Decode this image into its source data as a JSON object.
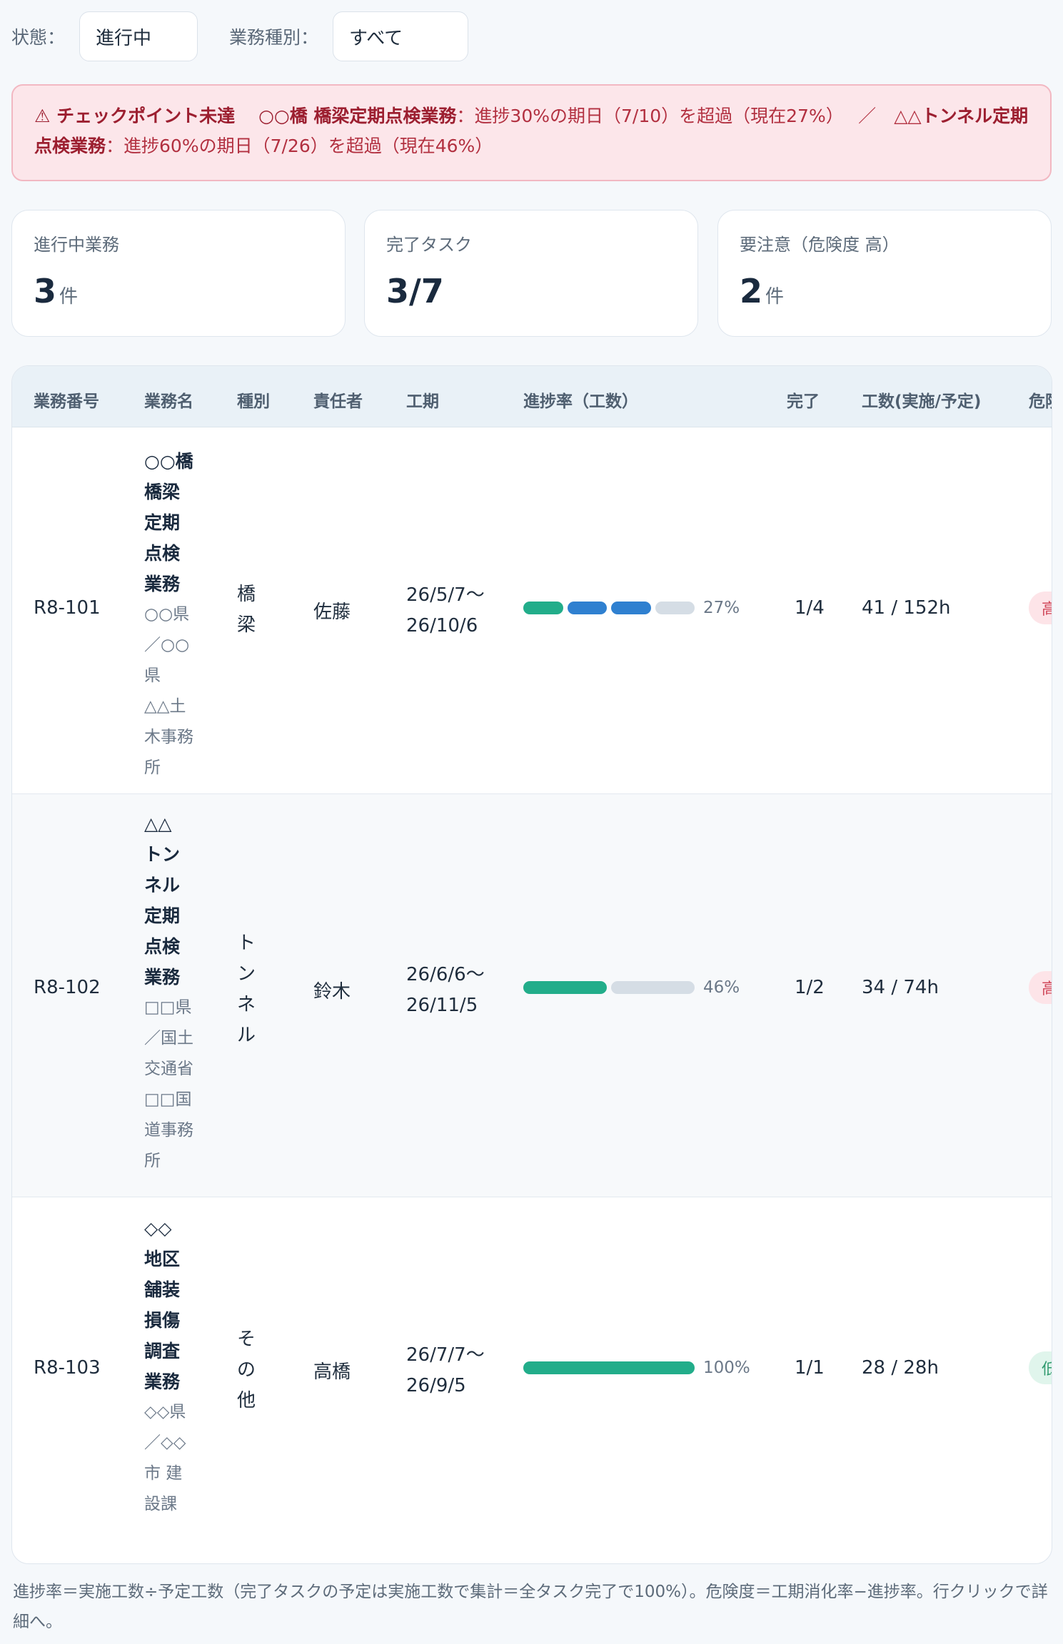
{
  "filters": {
    "status_label": "状態：",
    "status_value": "進行中",
    "type_label": "業務種別：",
    "type_value": "すべて"
  },
  "alert": {
    "icon_title": "⚠ チェックポイント未達",
    "item1_name": "○○橋 橋梁定期点検業務",
    "item1_text": "：進捗30%の期日（7/10）を超過（現在27%）",
    "separator": "／",
    "item2_prefix": "△△",
    "item2_name": "トンネル定期点検業務",
    "item2_text": "：進捗60%の期日（7/26）を超過（現在46%）"
  },
  "stats": [
    {
      "label": "進行中業務",
      "value": "3",
      "unit": "件"
    },
    {
      "label": "完了タスク",
      "value": "3/7",
      "unit": ""
    },
    {
      "label": "要注意（危険度 高）",
      "value": "2",
      "unit": "件"
    }
  ],
  "table": {
    "headers": [
      "業務番号",
      "業務名",
      "種別",
      "責任者",
      "工期",
      "進捗率（工数）",
      "完了",
      "工数(実施/予定)",
      "危険"
    ],
    "rows": [
      {
        "id": "R8-101",
        "name_lines": [
          "○○橋",
          "橋梁",
          "定期",
          "点検",
          "業務"
        ],
        "client_lines": [
          "○○県",
          "／○○",
          "県",
          "△△土",
          "木事務",
          "所"
        ],
        "type_lines": [
          "橋",
          "梁"
        ],
        "manager": "佐藤",
        "period_start": "26/5/7〜",
        "period_end": "26/10/6",
        "progress_percent": 27,
        "progress_segments": [
          "done",
          "active",
          "active",
          "pending"
        ],
        "progress_label": "27%",
        "done": "1/4",
        "hours": "41 / 152h",
        "risk": "高"
      },
      {
        "id": "R8-102",
        "name_lines": [
          "△△",
          "トン",
          "ネル",
          "定期",
          "点検",
          "業務"
        ],
        "client_lines": [
          "□□県",
          "／国土",
          "交通省",
          "□□国",
          "道事務",
          "所"
        ],
        "type_lines": [
          "ト",
          "ン",
          "ネ",
          "ル"
        ],
        "manager": "鈴木",
        "period_start": "26/6/6〜",
        "period_end": "26/11/5",
        "progress_percent": 46,
        "progress_segments": [
          "done",
          "pending"
        ],
        "progress_label": "46%",
        "done": "1/2",
        "hours": "34 / 74h",
        "risk": "高"
      },
      {
        "id": "R8-103",
        "name_lines": [
          "◇◇",
          "地区",
          "舗装",
          "損傷",
          "調査",
          "業務"
        ],
        "client_lines": [
          "◇◇県",
          "／◇◇",
          "市 建",
          "設課"
        ],
        "type_lines": [
          "そ",
          "の",
          "他"
        ],
        "manager": "高橋",
        "period_start": "26/7/7〜",
        "period_end": "26/9/5",
        "progress_percent": 100,
        "progress_segments": [
          "done"
        ],
        "progress_label": "100%",
        "done": "1/1",
        "hours": "28 / 28h",
        "risk": "低"
      }
    ]
  },
  "footnote": "進捗率＝実施工数÷予定工数（完了タスクの予定は実施工数で集計＝全タスク完了で100%）。危険度＝工期消化率−進捗率。行クリックで詳細へ。",
  "colors": {
    "done": "#22ad8a",
    "active": "#2f80d0",
    "pending": "#d5dde5",
    "risk_high_bg": "#fde4e8",
    "risk_high_fg": "#d0485a",
    "risk_low_bg": "#e0f5ec",
    "risk_low_fg": "#2f9a6e"
  }
}
